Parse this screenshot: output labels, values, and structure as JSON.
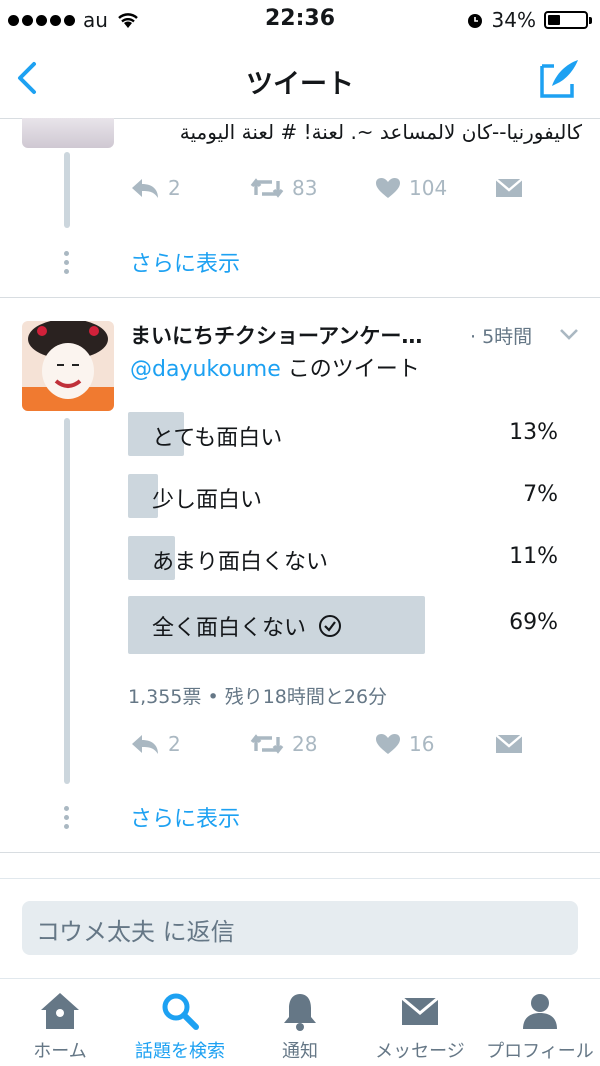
{
  "status_bar": {
    "carrier": "au",
    "time": "22:36",
    "battery": "34%",
    "battery_level": 0.34
  },
  "nav": {
    "title": "ツイート"
  },
  "prev_tweet": {
    "text": "كاليفورنيا--كان لالمساعد ~. لعنة! # لعنة اليومية",
    "replies": "2",
    "retweets": "83",
    "likes": "104",
    "show_more": "さらに表示"
  },
  "tweet": {
    "name": "まいにちチクショーアンケー…",
    "time": "· 5時間",
    "mention": "@dayukoume",
    "text": " このツイート",
    "poll": {
      "options": [
        {
          "label": "とても面白い",
          "percent": "13%",
          "value": 0.13
        },
        {
          "label": "少し面白い",
          "percent": "7%",
          "value": 0.07
        },
        {
          "label": "あまり面白くない",
          "percent": "11%",
          "value": 0.11
        },
        {
          "label": "全く面白くない",
          "percent": "69%",
          "value": 0.69
        }
      ],
      "votes": "1,355票",
      "remaining": "残り18時間と26分"
    },
    "replies": "2",
    "retweets": "28",
    "likes": "16",
    "show_more": "さらに表示"
  },
  "reply_box": {
    "placeholder": "コウメ太夫 に返信"
  },
  "tabs": [
    {
      "label": "ホーム",
      "icon": "home-icon"
    },
    {
      "label": "話題を検索",
      "icon": "search-icon",
      "active": true
    },
    {
      "label": "通知",
      "icon": "bell-icon"
    },
    {
      "label": "メッセージ",
      "icon": "envelope-icon"
    },
    {
      "label": "プロフィール",
      "icon": "person-icon"
    }
  ],
  "colors": {
    "accent": "#1da1f2",
    "muted": "#aab8c2",
    "poll_bar": "#ccd6dd"
  }
}
